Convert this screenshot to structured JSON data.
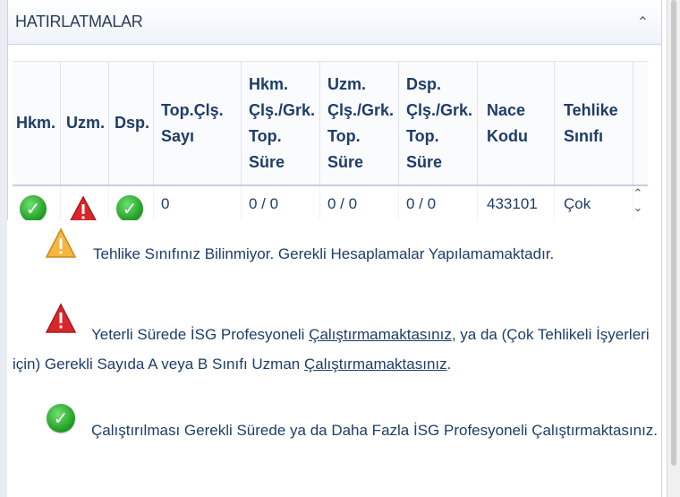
{
  "panel": {
    "title": "HATIRLATMALAR",
    "collapse_icon": "chevron-up-icon"
  },
  "grid": {
    "columns": [
      "Hkm.",
      "Uzm.",
      "Dsp.",
      "Top.Çlş.\nSayı",
      "Hkm.\nÇlş./Grk.\nTop.\nSüre",
      "Uzm.\nÇlş./Grk.\nTop.\nSüre",
      "Dsp.\nÇlş./Grk.\nTop.\nSüre",
      "Nace\nKodu",
      "Tehlike\nSınıfı"
    ],
    "row": {
      "hkm_icon": "check-icon",
      "uzm_icon": "red-warning-icon",
      "dsp_icon": "check-icon",
      "top_cls_sayi": "0",
      "hkm_sure": "0 / 0",
      "uzm_sure": "0 / 0",
      "dsp_sure": "0 / 0",
      "nace_kodu": "433101",
      "tehlike_sinifi": "Çok"
    }
  },
  "legend": {
    "unknown": {
      "icon": "yellow-warning-icon",
      "text": "Tehlike Sınıfınız Bilinmiyor. Gerekli Hesaplamalar Yapılamamaktadır."
    },
    "insufficient": {
      "icon": "red-warning-icon",
      "text_1": "Yeterli Sürede İSG Profesyoneli ",
      "link_1": "Çalıştırmamaktasınız",
      "text_2": ", ya da (Çok Tehlikeli İşyerleri",
      "text_3": "için) Gerekli Sayıda A veya B Sınıfı Uzman ",
      "link_2": "Çalıştırmamaktasınız",
      "text_4": "."
    },
    "ok": {
      "icon": "check-icon",
      "text": "Çalıştırılması Gerekli Sürede ya da Daha Fazla İSG Profesyoneli Çalıştırmaktasınız."
    }
  }
}
